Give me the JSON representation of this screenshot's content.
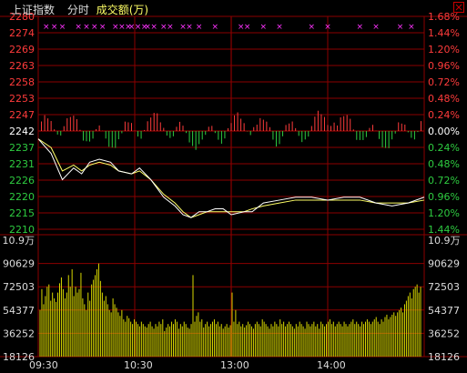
{
  "header": {
    "index_name": "上证指数",
    "mode": "分时",
    "volume_label": "成交额(万)"
  },
  "colors": {
    "background": "#000000",
    "grid": "#8b0000",
    "up": "#ff3b3b",
    "down": "#2ecc40",
    "flat": "#ffffff",
    "price_line": "#ffffff",
    "avg_line": "#ffff66",
    "volume_bar": "#d7d700",
    "markers": "#ff33ff",
    "text": "#dcdcdc"
  },
  "icons": {
    "close": "close-icon"
  },
  "chart_data": {
    "type": "line",
    "price_axis": {
      "left_labels": [
        "2280",
        "2274",
        "2269",
        "2263",
        "2258",
        "2253",
        "2247",
        "2242",
        "2237",
        "2231",
        "2226",
        "2220",
        "2215",
        "2210"
      ],
      "right_labels": [
        "1.68%",
        "1.44%",
        "1.20%",
        "0.96%",
        "0.72%",
        "0.48%",
        "0.24%",
        "0.00%",
        "0.24%",
        "0.48%",
        "0.72%",
        "0.96%",
        "1.20%",
        "1.44%"
      ],
      "baseline": 2242,
      "ylim": [
        2207,
        2280
      ]
    },
    "volume_axis": {
      "left_labels": [
        "10.9万",
        "90629",
        "72503",
        "54377",
        "36252",
        "18126"
      ],
      "right_labels": [
        "10.9万",
        "90629",
        "72503",
        "54377",
        "36252",
        "18126"
      ]
    },
    "time_axis": {
      "labels": [
        "09:30",
        "10:30",
        "13:00",
        "14:00"
      ],
      "sessions": 240
    },
    "price_series": {
      "name": "",
      "x": [
        0,
        8,
        15,
        22,
        27,
        32,
        38,
        45,
        50,
        58,
        63,
        70,
        78,
        85,
        90,
        95,
        100,
        105,
        110,
        115,
        120,
        128,
        133,
        140,
        150,
        160,
        170,
        180,
        190,
        200,
        210,
        220,
        230,
        240
      ],
      "values": [
        2238,
        2233,
        2224,
        2228,
        2226,
        2230,
        2231,
        2230,
        2227,
        2226,
        2228,
        2224,
        2218,
        2215,
        2212,
        2211,
        2213,
        2213,
        2214,
        2214,
        2212,
        2213,
        2213,
        2216,
        2217,
        2218,
        2218,
        2217,
        2218,
        2218,
        2216,
        2215,
        2216,
        2218
      ]
    },
    "avg_series": {
      "name": "",
      "x": [
        0,
        8,
        15,
        22,
        27,
        32,
        38,
        45,
        50,
        58,
        63,
        70,
        78,
        85,
        90,
        95,
        100,
        105,
        110,
        115,
        120,
        128,
        133,
        140,
        150,
        160,
        170,
        180,
        190,
        200,
        210,
        220,
        230,
        240
      ],
      "values": [
        2238,
        2235,
        2227,
        2229,
        2227,
        2229,
        2230,
        2229,
        2227,
        2226,
        2227,
        2224,
        2219,
        2216,
        2213,
        2211,
        2212,
        2213,
        2213,
        2213,
        2213,
        2213,
        2214,
        2215,
        2216,
        2217,
        2217,
        2217,
        2217,
        2217,
        2216,
        2216,
        2216,
        2217
      ]
    },
    "momentum_bars": [
      {
        "x": [
          18,
          22,
          26,
          30,
          34,
          38,
          42,
          46,
          50,
          54,
          58,
          62,
          66,
          70,
          74,
          78,
          82,
          86,
          90,
          94,
          98,
          102,
          106,
          110
        ],
        "dir": [
          1,
          1,
          1,
          -1,
          -1,
          1,
          1,
          -1,
          -1,
          1,
          1,
          -1,
          -1,
          -1,
          -1,
          1,
          1,
          -1,
          1,
          1,
          1,
          -1,
          1,
          1
        ],
        "mag": [
          2,
          4,
          3,
          2,
          3,
          2,
          3,
          4,
          3,
          2,
          3,
          4,
          5,
          3,
          2,
          2,
          3,
          2,
          3,
          4,
          2,
          2,
          3,
          2
        ]
      }
    ],
    "volume": {
      "values": [
        40,
        58,
        45,
        52,
        60,
        62,
        48,
        55,
        50,
        47,
        55,
        63,
        68,
        58,
        50,
        55,
        70,
        60,
        75,
        52,
        60,
        55,
        58,
        72,
        50,
        45,
        40,
        55,
        48,
        62,
        66,
        70,
        75,
        80,
        65,
        55,
        48,
        52,
        45,
        40,
        38,
        50,
        45,
        42,
        38,
        35,
        40,
        32,
        30,
        35,
        33,
        30,
        28,
        32,
        30,
        28,
        26,
        30,
        28,
        26,
        25,
        28,
        30,
        26,
        24,
        28,
        26,
        30,
        28,
        32,
        22,
        25,
        28,
        26,
        30,
        28,
        32,
        30,
        24,
        28,
        26,
        30,
        28,
        25,
        24,
        28,
        70,
        30,
        35,
        38,
        30,
        32,
        25,
        28,
        30,
        26,
        28,
        30,
        32,
        28,
        30,
        26,
        28,
        24,
        26,
        28,
        25,
        27,
        55,
        30,
        40,
        28,
        30,
        26,
        28,
        25,
        27,
        30,
        28,
        26,
        24,
        28,
        30,
        28,
        26,
        32,
        30,
        28,
        26,
        24,
        28,
        26,
        30,
        28,
        26,
        32,
        28,
        30,
        26,
        28,
        30,
        28,
        26,
        24,
        28,
        26,
        30,
        28,
        26,
        24,
        30,
        28,
        26,
        28,
        30,
        26,
        28,
        24,
        30,
        28,
        26,
        28,
        30,
        32,
        28,
        30,
        26,
        28,
        30,
        28,
        26,
        30,
        28,
        26,
        28,
        30,
        32,
        28,
        30,
        28,
        26,
        30,
        28,
        30,
        32,
        30,
        28,
        30,
        32,
        34,
        30,
        28,
        32,
        30,
        34,
        36,
        32,
        34,
        36,
        38,
        35,
        38,
        40,
        42,
        38,
        45,
        48,
        52,
        55,
        50,
        58,
        60,
        62,
        55,
        60
      ],
      "vmax": 109000
    },
    "markers": {
      "positions": [
        5,
        10,
        15,
        25,
        30,
        35,
        40,
        48,
        52,
        56,
        58,
        62,
        66,
        68,
        72,
        78,
        82,
        90,
        94,
        100,
        110,
        126,
        130,
        140,
        150,
        170,
        180,
        200,
        210,
        225,
        232
      ]
    }
  }
}
